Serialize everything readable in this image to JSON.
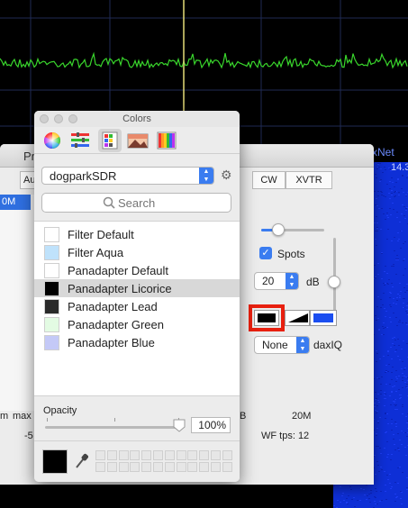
{
  "background": {
    "daxnet_label": "xNet",
    "freq_label": "14.3"
  },
  "preferences_window": {
    "title": "Pr",
    "tabs": {
      "au": "Au",
      "cw": "CW",
      "xvtr": "XVTR"
    },
    "selected_band": "0M",
    "spots_label": "Spots",
    "spots_checked": true,
    "db_value": "20",
    "db_unit": "dB",
    "daxiq_value": "None",
    "daxiq_label": "daxIQ",
    "wf_tps": "WF tps: 12",
    "band_20m": "20M",
    "left_bottom": {
      "m": "m",
      "max": "max",
      "neg5": "-5",
      "b": "B"
    },
    "swatch_colors": {
      "black": "#000000",
      "blue": "#1b4ef0"
    }
  },
  "colors_panel": {
    "title": "Colors",
    "toolbar": {
      "icons": [
        "color-wheel-icon",
        "color-sliders-icon",
        "color-palettes-icon",
        "image-palettes-icon",
        "crayons-icon"
      ]
    },
    "palette_name": "dogparkSDR",
    "search_placeholder": "Search",
    "colors": [
      {
        "name": "Filter Default",
        "color": "#ffffff"
      },
      {
        "name": "Filter Aqua",
        "color": "#bfe2fb"
      },
      {
        "name": "Panadapter Default",
        "color": "#ffffff"
      },
      {
        "name": "Panadapter Licorice",
        "color": "#000000"
      },
      {
        "name": "Panadapter Lead",
        "color": "#2a2a2a"
      },
      {
        "name": "Panadapter Green",
        "color": "#e3fbe3"
      },
      {
        "name": "Panadapter Blue",
        "color": "#c4c9f7"
      }
    ],
    "selected_index": 3,
    "opacity_label": "Opacity",
    "opacity_value": "100%",
    "opacity_fraction": 1.0,
    "current_color": "#000000"
  }
}
